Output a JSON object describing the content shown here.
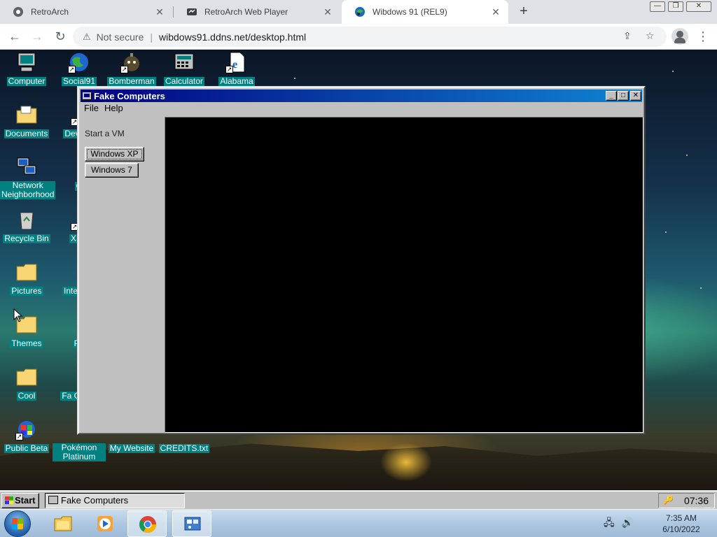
{
  "browser": {
    "tabs": [
      {
        "title": "RetroArch",
        "active": false
      },
      {
        "title": "RetroArch Web Player",
        "active": false
      },
      {
        "title": "Wibdows 91 (REL9)",
        "active": true
      }
    ],
    "new_tab_symbol": "+",
    "close_symbol": "✕",
    "omnibox": {
      "security_label": "Not secure",
      "url": "wibdows91.ddns.net/desktop.html"
    }
  },
  "desktop_icons": [
    {
      "label": "Computer",
      "icon": "computer-icon"
    },
    {
      "label": "Social91",
      "icon": "globe-icon"
    },
    {
      "label": "Bomberman",
      "icon": "bomberman-icon"
    },
    {
      "label": "Calculator",
      "icon": "calculator-icon"
    },
    {
      "label": "Alabama",
      "icon": "ie-document-icon"
    },
    {
      "label": "Documents",
      "icon": "folder-documents-icon"
    },
    {
      "label": "Network Neighborhood",
      "icon": "network-icon"
    },
    {
      "label": "Recycle Bin",
      "icon": "recycle-bin-icon"
    },
    {
      "label": "Pictures",
      "icon": "folder-icon"
    },
    {
      "label": "Themes",
      "icon": "folder-icon"
    },
    {
      "label": "Cool",
      "icon": "folder-icon"
    },
    {
      "label": "Public Beta",
      "icon": "public-beta-icon"
    },
    {
      "label": "Pokémon Platinum",
      "icon": "pokemon-icon"
    },
    {
      "label": "My Website",
      "icon": "website-icon"
    },
    {
      "label": "CREDITS.txt",
      "icon": "text-file-icon"
    },
    {
      "label": "Deve In",
      "icon": "dev-icon"
    },
    {
      "label": "C",
      "icon": "app-icon"
    },
    {
      "label": "XSS",
      "icon": "app-icon"
    },
    {
      "label": "Inte Exp",
      "icon": "ie-icon"
    },
    {
      "label": "Pa",
      "icon": "paint-icon"
    },
    {
      "label": "Fa Comp",
      "icon": "fake-computers-icon"
    }
  ],
  "vm_window": {
    "title": "Fake Computers",
    "menu": {
      "file": "File",
      "help": "Help"
    },
    "sidebar_label": "Start a VM",
    "buttons": {
      "xp": "Windows XP",
      "w7": "Windows 7"
    },
    "controls": {
      "minimize": "_",
      "maximize": "□",
      "close": "✕"
    }
  },
  "w95_taskbar": {
    "start_label": "Start",
    "task_label": "Fake Computers",
    "clock": "07:36"
  },
  "w7_taskbar": {
    "time": "7:35 AM",
    "date": "6/10/2022",
    "pinned": [
      "explorer-icon",
      "media-player-icon",
      "chrome-icon",
      "control-panel-icon"
    ]
  }
}
